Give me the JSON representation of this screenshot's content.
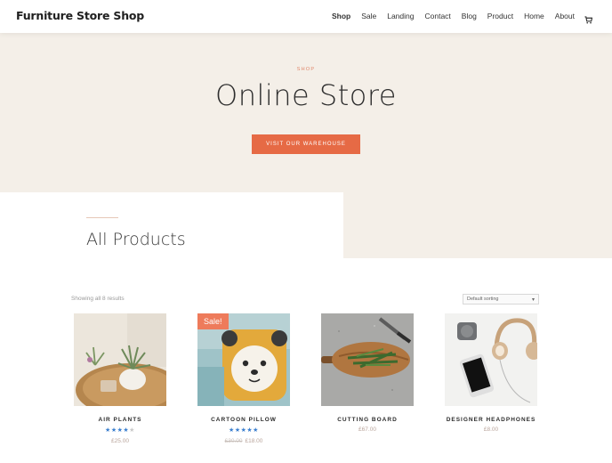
{
  "header": {
    "site_title": "Furniture Store Shop",
    "nav": [
      "Shop",
      "Sale",
      "Landing",
      "Contact",
      "Blog",
      "Product",
      "Home",
      "About"
    ],
    "active_nav": "Shop",
    "cart_icon": "cart-icon"
  },
  "hero": {
    "eyebrow": "SHOP",
    "title": "Online Store",
    "button_label": "VISIT OUR WAREHOUSE"
  },
  "section": {
    "title": "All Products"
  },
  "shop_bar": {
    "result_count": "Showing all 8 results",
    "sort_value": "Default sorting"
  },
  "products": [
    {
      "name": "AIR PLANTS",
      "rating": 3.5,
      "price": "£25.00",
      "old_price": "",
      "sale": false
    },
    {
      "name": "CARTOON PILLOW",
      "rating": 5,
      "price": "£18.00",
      "old_price": "£30.00",
      "sale": true,
      "badge": "Sale!"
    },
    {
      "name": "CUTTING BOARD",
      "rating": 0,
      "price": "£67.00",
      "old_price": "",
      "sale": false
    },
    {
      "name": "DESIGNER HEADPHONES",
      "rating": 0,
      "price": "£8.00",
      "old_price": "",
      "sale": false
    }
  ],
  "colors": {
    "accent": "#e66a45",
    "hero_bg": "#f4efe8",
    "star": "#3b7fcf",
    "sale_badge": "#ee7b5b"
  }
}
